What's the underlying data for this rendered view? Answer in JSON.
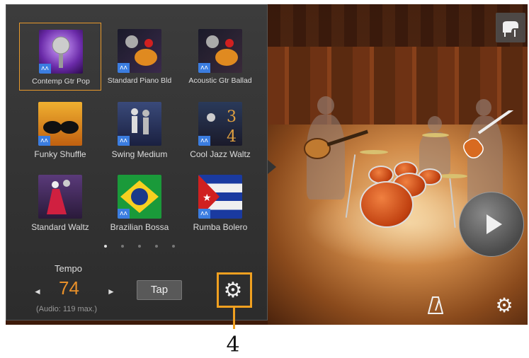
{
  "styles": [
    {
      "label": "Contemp Gtr Pop",
      "selected": true,
      "icon": "microphone-icon",
      "badge": "audio-icon"
    },
    {
      "label": "Standard Piano Bld",
      "selected": false,
      "icon": "microphone-guitar-icon",
      "badge": "audio-icon"
    },
    {
      "label": "Acoustic Gtr Ballad",
      "selected": false,
      "icon": "microphone-guitar-icon",
      "badge": "audio-icon"
    },
    {
      "label": "Funky Shuffle",
      "selected": false,
      "icon": "sunglasses-icon",
      "badge": "audio-icon"
    },
    {
      "label": "Swing Medium",
      "selected": false,
      "icon": "dancers-icon",
      "badge": "audio-icon"
    },
    {
      "label": "Cool Jazz Waltz",
      "selected": false,
      "icon": "jazz-34-icon",
      "badge": "audio-icon"
    },
    {
      "label": "Standard Waltz",
      "selected": false,
      "icon": "ballroom-dancers-icon",
      "badge": "none"
    },
    {
      "label": "Brazilian Bossa",
      "selected": false,
      "icon": "brazil-flag-icon",
      "badge": "audio-icon"
    },
    {
      "label": "Rumba Bolero",
      "selected": false,
      "icon": "cuba-flag-icon",
      "badge": "audio-icon"
    }
  ],
  "pagination": {
    "pages": 5,
    "current": 1
  },
  "tempo": {
    "label": "Tempo",
    "value": "74",
    "note": "(Audio: 119 max.)",
    "tap_label": "Tap",
    "left_arrow": "◄",
    "right_arrow": "►"
  },
  "controls": {
    "piano_icon": "piano-icon",
    "play_icon": "play-icon",
    "metronome_icon": "metronome-icon",
    "settings_icon": "gear-icon"
  },
  "callout": {
    "number": "4"
  },
  "colors": {
    "accent": "#e8902a",
    "callout": "#f0a020",
    "badge": "#3b7de0"
  }
}
